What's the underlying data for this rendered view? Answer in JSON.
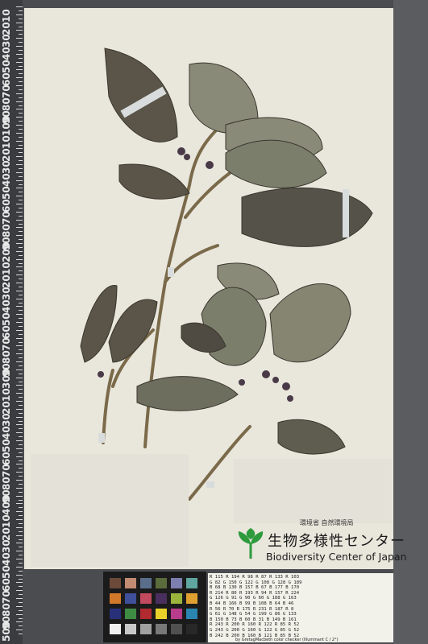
{
  "ruler": {
    "labels": [
      "10",
      "20",
      "30",
      "40",
      "50",
      "60",
      "70",
      "80",
      "90",
      "100",
      "10",
      "20",
      "30",
      "40",
      "50",
      "60",
      "70",
      "80",
      "90",
      "200",
      "10",
      "20",
      "30",
      "40",
      "50",
      "60",
      "70",
      "80",
      "90",
      "300",
      "10",
      "20",
      "30",
      "40",
      "50",
      "60",
      "70",
      "80",
      "90",
      "400",
      "10",
      "20",
      "30",
      "40",
      "50",
      "60",
      "70",
      "80",
      "90",
      "500"
    ]
  },
  "logo": {
    "org_small": "環境省 自然環境局",
    "name_jp": "生物多様性センター",
    "name_en": "Biodiversity Center of Japan"
  },
  "color_card": {
    "swatches": [
      "#6b4a3a",
      "#c28b72",
      "#5a6e8c",
      "#5a6b3c",
      "#7d7fb0",
      "#5fa6a0",
      "#d2782a",
      "#3f4f9a",
      "#c24a5e",
      "#4a2f5e",
      "#9ab43c",
      "#e0a030",
      "#28307a",
      "#3e8c44",
      "#b02a30",
      "#e8d22a",
      "#b83c8c",
      "#2a86b0",
      "#f0f0f0",
      "#c8c8c8",
      "#a0a0a0",
      "#787878",
      "#505050",
      "#282828"
    ]
  },
  "target_table": {
    "rows": [
      "R 115  R 194  R  98  R  87  R 133  R 103",
      "G  82  G 150  G 122  G 108  G 128  G 189",
      "B  68  B 130  B 157  B  67  B 177  B 170",
      "R 214  R  80  R 193  R  94  R 157  R 224",
      "G 126  G  91  G  90  G  60  G 188  G 163",
      "B  44  B 166  B  99  B 108  B  64  B  46",
      "R  56  R  70  R 175  R 231  R 187  R   8",
      "G  61  G 148  G  54  G 199  G  86  G 133",
      "B 150  B  73  B  60  B  31  B 149  B 161",
      "R 243  R 200  R 160  R 122  R  85  R  52",
      "G 243  G 200  G 160  G 122  G  85  G  52",
      "B 242  B 200  B 160  B 121  B  85  B  52"
    ],
    "footnote": "by GretagMacbeth color checker (Illuminant C / 2°)"
  }
}
